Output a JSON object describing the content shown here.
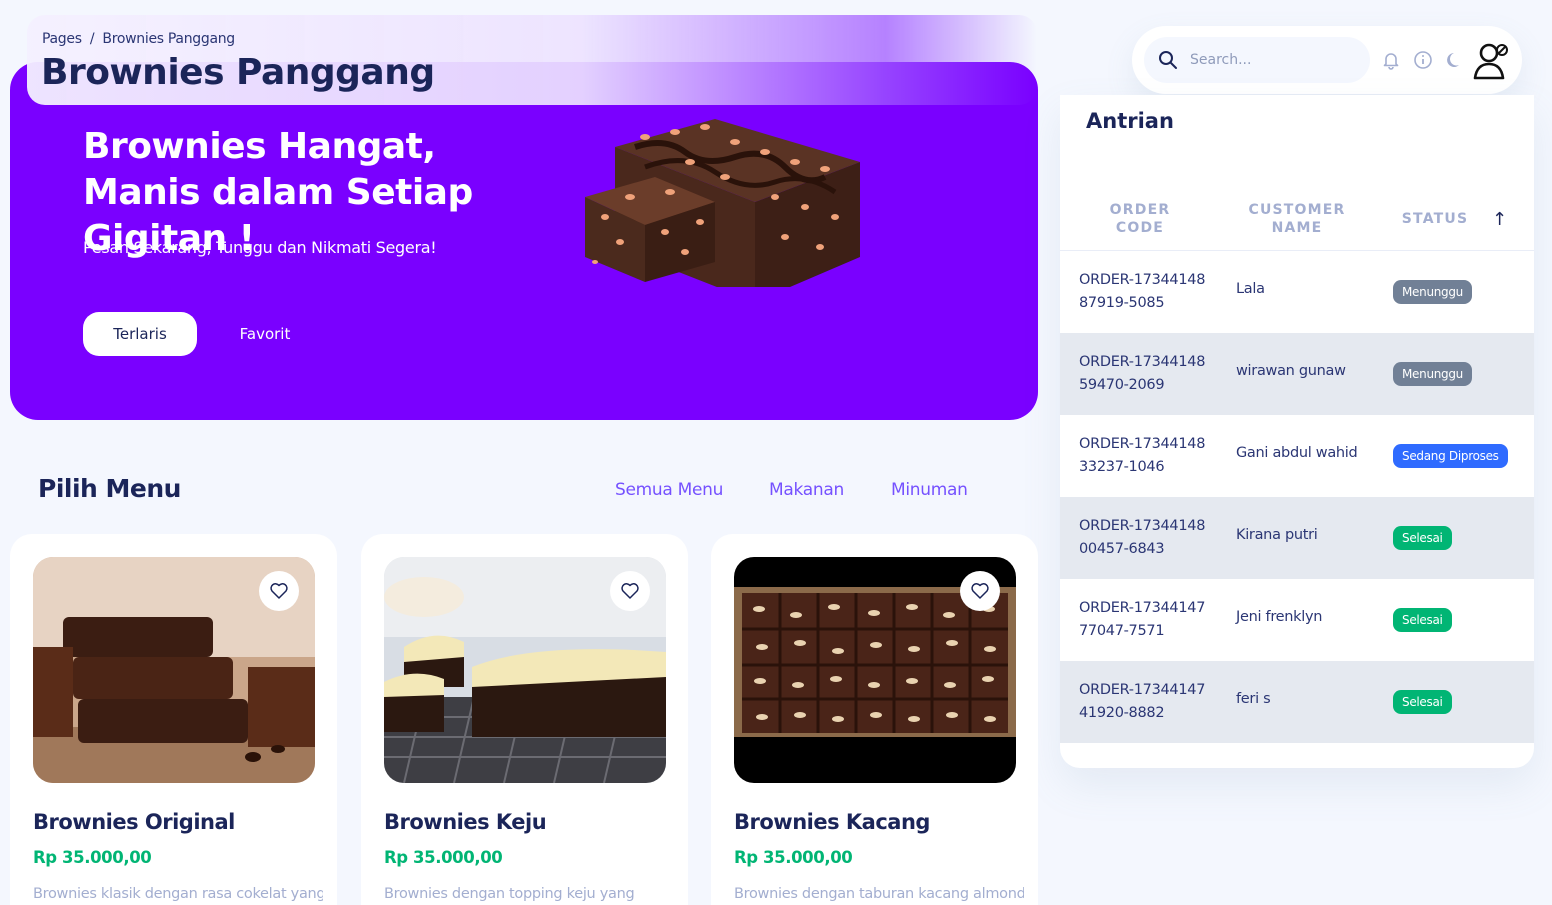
{
  "breadcrumb": {
    "root": "Pages",
    "separator": "/",
    "current": "Brownies Panggang"
  },
  "page_title": "Brownies Panggang",
  "hero": {
    "title": "Brownies Hangat, Manis dalam Setiap Gigitan !",
    "subtitle": "Pesan Sekarang, Tunggu dan Nikmati Segera!",
    "primary_button": "Terlaris",
    "secondary_button": "Favorit"
  },
  "search": {
    "placeholder": "Search..."
  },
  "nav_icons": [
    "bell-icon",
    "info-icon",
    "moon-icon",
    "user-avatar-icon"
  ],
  "queue": {
    "title": "Antrian",
    "columns": {
      "code": "ORDER CODE",
      "code_line1": "ORDER",
      "code_line2": "CODE",
      "name_line1": "CUSTOMER",
      "name_line2": "NAME",
      "status": "STATUS"
    },
    "sort_icon": "↑",
    "rows": [
      {
        "code1": "ORDER-17344148",
        "code2": "87919-5085",
        "name": "Lala",
        "status": "Menunggu",
        "status_type": "waiting"
      },
      {
        "code1": "ORDER-17344148",
        "code2": "59470-2069",
        "name": "wirawan gunaw",
        "status": "Menunggu",
        "status_type": "waiting"
      },
      {
        "code1": "ORDER-17344148",
        "code2": "33237-1046",
        "name": "Gani abdul wahid",
        "status": "Sedang Diproses",
        "status_type": "process"
      },
      {
        "code1": "ORDER-17344148",
        "code2": "00457-6843",
        "name": "Kirana putri",
        "status": "Selesai",
        "status_type": "done"
      },
      {
        "code1": "ORDER-17344147",
        "code2": "77047-7571",
        "name": "Jeni frenklyn",
        "status": "Selesai",
        "status_type": "done"
      },
      {
        "code1": "ORDER-17344147",
        "code2": "41920-8882",
        "name": "feri s",
        "status": "Selesai",
        "status_type": "done"
      }
    ]
  },
  "menu": {
    "title": "Pilih Menu",
    "filters": [
      "Semua Menu",
      "Makanan",
      "Minuman"
    ],
    "products": [
      {
        "name": "Brownies Original",
        "price": "Rp 35.000,00",
        "description": "Brownies klasik dengan rasa cokelat yang"
      },
      {
        "name": "Brownies Keju",
        "price": "Rp 35.000,00",
        "description": "Brownies dengan topping keju yang"
      },
      {
        "name": "Brownies Kacang",
        "price": "Rp 35.000,00",
        "description": "Brownies dengan taburan kacang almond"
      }
    ]
  },
  "colors": {
    "brand": "#7a00ff",
    "accent": "#7551ff",
    "price": "#01b574",
    "waiting": "#718096",
    "process": "#2f6bff",
    "done": "#01b574"
  }
}
